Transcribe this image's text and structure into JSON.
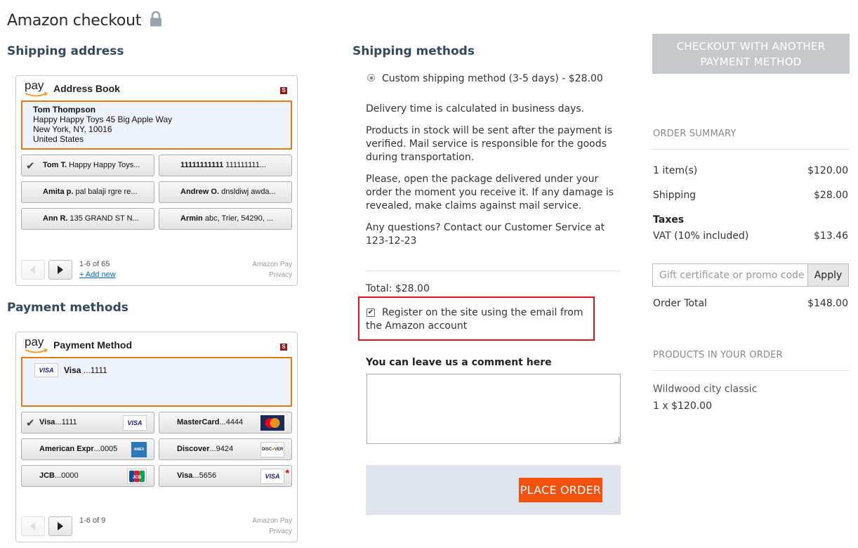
{
  "page": {
    "title": "Amazon checkout"
  },
  "shipping_address": {
    "title": "Shipping address",
    "widget_title": "Address Book",
    "pay_logo": "pay",
    "selected": {
      "name": "Tom Thompson",
      "line1": "Happy Happy Toys 45 Big Apple Way",
      "line2": "New York, NY, 10016",
      "line3": "United States"
    },
    "options": [
      {
        "name": "Tom T.",
        "detail": " Happy Happy Toys..."
      },
      {
        "name": "11111111111",
        "detail": " 111111111..."
      },
      {
        "name": "Amita p.",
        "detail": " pal balaji rgre re..."
      },
      {
        "name": "Andrew O.",
        "detail": " dnsldiwj awda..."
      },
      {
        "name": "Ann R.",
        "detail": " 135 GRAND ST N..."
      },
      {
        "name": "Armin",
        "detail": " abc, Trier, 54290, ..."
      }
    ],
    "pager_count": "1-6 of 65",
    "add_new": "+ Add new",
    "footer_brand": "Amazon Pay",
    "footer_privacy": "Privacy"
  },
  "payment_methods": {
    "title": "Payment methods",
    "widget_title": "Payment Method",
    "pay_logo": "pay",
    "selected": {
      "brand": "VISA",
      "name": "Visa",
      "number": " ...1111"
    },
    "options": [
      {
        "name": "Visa",
        "number": "...1111",
        "logo": "VISA"
      },
      {
        "name": "MasterCard",
        "number": "...4444",
        "logo": "MC"
      },
      {
        "name": "American Expr",
        "number": "...0005",
        "logo": "AMEX"
      },
      {
        "name": "Discover",
        "number": "...9424",
        "logo": "DISCOVER"
      },
      {
        "name": "JCB",
        "number": "...0000",
        "logo": "JCB"
      },
      {
        "name": "Visa",
        "number": "...5656",
        "logo": "VISA"
      }
    ],
    "pager_count": "1-6 of 9",
    "footer_brand": "Amazon Pay",
    "footer_privacy": "Privacy"
  },
  "shipping_methods": {
    "title": "Shipping methods",
    "method": "Custom shipping method (3-5 days) - $28.00",
    "desc1": "Delivery time is calculated in business days.",
    "desc2": "Products in stock will be sent after the payment is verified. Mail service is responsible for the goods during transportation.",
    "desc3": "Please, open the package delivered under your order the moment you receive it. If any damage is revealed, make claims against mail service.",
    "desc4": "Any questions? Contact our Customer Service at 123-12-23",
    "total": "Total: $28.00",
    "register_label": "Register on the site using the email from the Amazon account",
    "register_checked": true,
    "comment_label": "You can leave us a comment here",
    "comment_value": "",
    "place_order": "PLACE ORDER"
  },
  "sidebar": {
    "alt_checkout": "CHECKOUT WITH ANOTHER PAYMENT METHOD",
    "order_summary_title": "ORDER SUMMARY",
    "items_label": "1 item(s)",
    "items_value": "$120.00",
    "shipping_label": "Shipping",
    "shipping_value": "$28.00",
    "taxes_label": "Taxes",
    "vat_label": "VAT (10% included)",
    "vat_value": "$13.46",
    "promo_placeholder": "Gift certificate or promo code",
    "apply_label": "Apply",
    "order_total_label": "Order Total",
    "order_total_value": "$148.00",
    "products_title": "PRODUCTS IN YOUR ORDER",
    "product_name": "Wildwood city classic",
    "product_qty": "1 x $120.00"
  },
  "colors": {
    "accent_orange": "#f2520e",
    "amazon_selection": "#e47911",
    "highlight_red": "#e01020",
    "heading_blue": "#34495e"
  }
}
